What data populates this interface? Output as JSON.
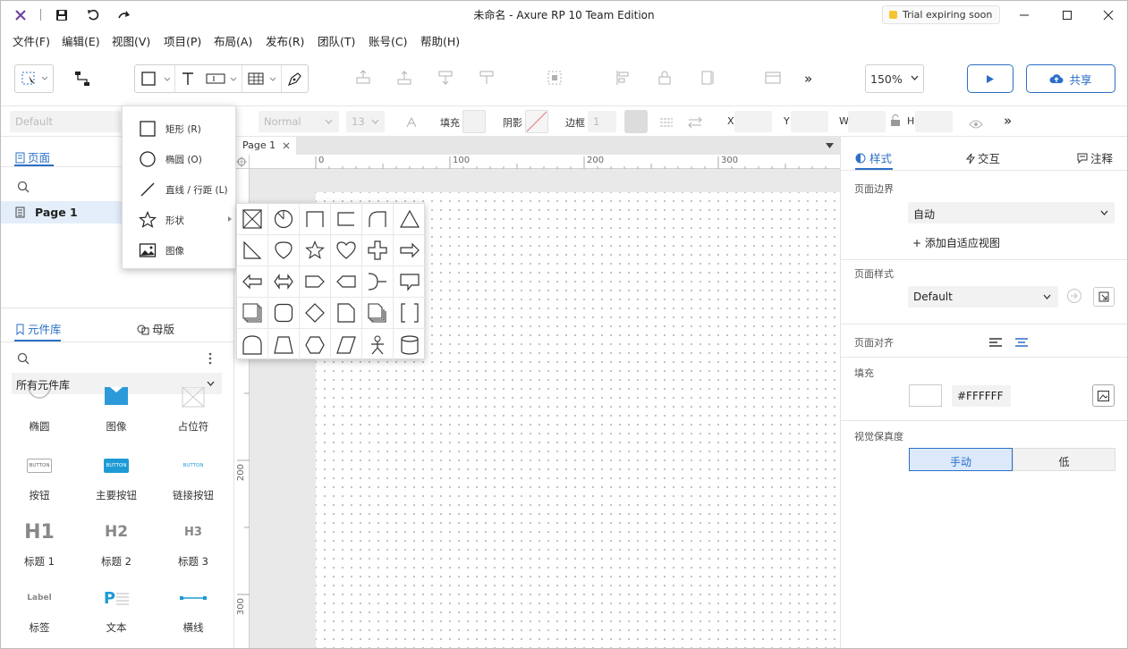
{
  "titlebar": {
    "title": "未命名 - Axure RP 10 Team Edition",
    "trial_badge": "Trial expiring soon",
    "icons": [
      "axure-logo-icon",
      "save-icon",
      "undo-icon",
      "redo-icon",
      "minimize-icon",
      "maximize-icon",
      "close-icon"
    ]
  },
  "menubar": {
    "items": [
      "文件(F)",
      "编辑(E)",
      "视图(V)",
      "项目(P)",
      "布局(A)",
      "发布(R)",
      "团队(T)",
      "账号(C)",
      "帮助(H)"
    ]
  },
  "toolbar": {
    "zoom": "150%",
    "share_label": "共享",
    "more": "»"
  },
  "stylebar": {
    "font_family": "Default",
    "font_weight": "Normal",
    "font_size": "13",
    "fill_label": "填充",
    "shadow_label": "阴影",
    "border_label": "边框",
    "border_width": "1",
    "x_label": "X",
    "y_label": "Y",
    "w_label": "W",
    "h_label": "H"
  },
  "pages_panel": {
    "tab_label": "页面",
    "items": [
      {
        "label": "Page 1"
      }
    ]
  },
  "library_panel": {
    "tab_label": "元件库",
    "masters_label": "母版",
    "selected_library": "所有元件库",
    "widgets": [
      {
        "label": "椭圆",
        "icon": "ellipse-icon"
      },
      {
        "label": "图像",
        "icon": "image-icon"
      },
      {
        "label": "占位符",
        "icon": "placeholder-icon"
      },
      {
        "label": "按钮",
        "icon": "button-icon",
        "preview": "BUTTON"
      },
      {
        "label": "主要按钮",
        "icon": "primary-button-icon",
        "preview": "BUTTON"
      },
      {
        "label": "链接按钮",
        "icon": "link-button-icon",
        "preview": "BUTTON"
      },
      {
        "label": "标题 1",
        "icon": "heading1-icon",
        "preview": "H1"
      },
      {
        "label": "标题 2",
        "icon": "heading2-icon",
        "preview": "H2"
      },
      {
        "label": "标题 3",
        "icon": "heading3-icon",
        "preview": "H3"
      },
      {
        "label": "标签",
        "icon": "label-icon",
        "preview": "Label"
      },
      {
        "label": "文本",
        "icon": "text-icon",
        "preview": "P"
      },
      {
        "label": "横线",
        "icon": "horizontal-line-icon"
      }
    ]
  },
  "canvas": {
    "tab_label": "Page 1",
    "ruler_top": [
      "0",
      "100",
      "200",
      "300"
    ],
    "ruler_left": [
      "200",
      "300"
    ]
  },
  "shape_menu": {
    "items": [
      {
        "label": "矩形 (R)",
        "icon": "rectangle-icon"
      },
      {
        "label": "椭圆 (O)",
        "icon": "circle-icon"
      },
      {
        "label": "直线 / 行距 (L)",
        "icon": "line-icon"
      },
      {
        "label": "形状",
        "icon": "star-icon"
      },
      {
        "label": "图像",
        "icon": "image-icon"
      }
    ]
  },
  "right_panel": {
    "tabs": [
      "样式",
      "交互",
      "注释"
    ],
    "page_bounds_label": "页面边界",
    "page_bounds_value": "自动",
    "add_adaptive_view": "+ 添加自适应视图",
    "page_style_label": "页面样式",
    "page_style_value": "Default",
    "page_align_label": "页面对齐",
    "fill_label": "填充",
    "fill_value": "#FFFFFF",
    "fidelity_label": "视觉保真度",
    "fidelity_options": [
      "手动",
      "低"
    ],
    "fidelity_selected": "手动"
  },
  "colors": {
    "accent": "#2b6fc6",
    "trial_dot": "#f6c531",
    "selected_row": "#e4eefa"
  }
}
